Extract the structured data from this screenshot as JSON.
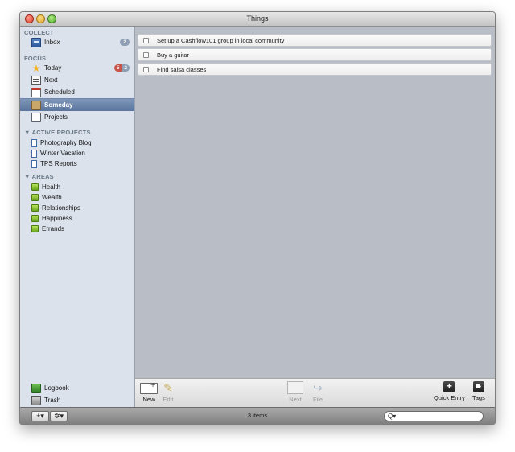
{
  "window": {
    "title": "Things"
  },
  "sidebar": {
    "collect_header": "COLLECT",
    "inbox": {
      "label": "Inbox",
      "badge": "2"
    },
    "focus_header": "FOCUS",
    "today": {
      "label": "Today",
      "badge_red": "5",
      "badge_gray": "2"
    },
    "next": {
      "label": "Next"
    },
    "scheduled": {
      "label": "Scheduled"
    },
    "someday": {
      "label": "Someday"
    },
    "projects": {
      "label": "Projects"
    },
    "active_projects_header": "▼ ACTIVE PROJECTS",
    "active_projects": [
      "Photography Blog",
      "Winter Vacation",
      "TPS Reports"
    ],
    "areas_header": "▼ AREAS",
    "areas": [
      "Health",
      "Wealth",
      "Relationships",
      "Happiness",
      "Errands"
    ],
    "logbook": {
      "label": "Logbook"
    },
    "trash": {
      "label": "Trash"
    }
  },
  "tasks": [
    {
      "title": "Set up a Cashflow101 group in local community"
    },
    {
      "title": "Buy a guitar"
    },
    {
      "title": "Find salsa classes"
    }
  ],
  "toolbar": {
    "new_label": "New",
    "edit_label": "Edit",
    "next_label": "Next",
    "file_label": "File",
    "quick_entry_label": "Quick Entry",
    "tags_label": "Tags"
  },
  "statusbar": {
    "add_label": "+▾",
    "gear_label": "✲▾",
    "item_count": "3 items",
    "search_glyph": "Q▾",
    "search_value": ""
  },
  "colors": {
    "selection": "#5a759e",
    "sidebar_bg": "#dbe2ec",
    "list_bg": "#b9bec6",
    "today_badge": "#c8554b"
  }
}
